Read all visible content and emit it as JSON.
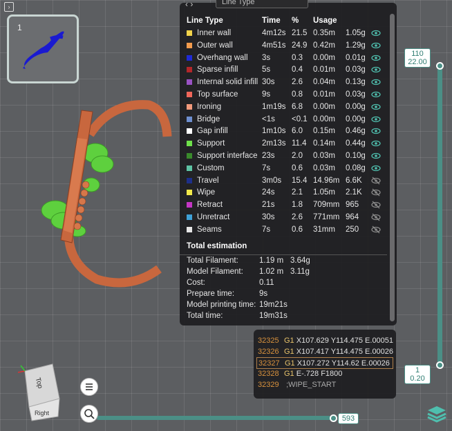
{
  "plate": {
    "number": "1"
  },
  "panel": {
    "header_label": "Line Type",
    "columns": {
      "type": "Line Type",
      "time": "Time",
      "pct": "%",
      "usage": "Usage"
    },
    "rows": [
      {
        "name": "Inner wall",
        "time": "4m12s",
        "pct": "21.5",
        "len": "0.35m",
        "wt": "1.05g",
        "color": "#f2d34a",
        "visible": true
      },
      {
        "name": "Outer wall",
        "time": "4m51s",
        "pct": "24.9",
        "len": "0.42m",
        "wt": "1.29g",
        "color": "#f29b4d",
        "visible": true
      },
      {
        "name": "Overhang wall",
        "time": "3s",
        "pct": "0.3",
        "len": "0.00m",
        "wt": "0.01g",
        "color": "#1f2bd6",
        "visible": true
      },
      {
        "name": "Sparse infill",
        "time": "5s",
        "pct": "0.4",
        "len": "0.01m",
        "wt": "0.03g",
        "color": "#b3272a",
        "visible": true
      },
      {
        "name": "Internal solid infill",
        "time": "30s",
        "pct": "2.6",
        "len": "0.04m",
        "wt": "0.13g",
        "color": "#9a52c4",
        "visible": true
      },
      {
        "name": "Top surface",
        "time": "9s",
        "pct": "0.8",
        "len": "0.01m",
        "wt": "0.03g",
        "color": "#f0665a",
        "visible": true
      },
      {
        "name": "Ironing",
        "time": "1m19s",
        "pct": "6.8",
        "len": "0.00m",
        "wt": "0.00g",
        "color": "#f29a7c",
        "visible": true
      },
      {
        "name": "Bridge",
        "time": "<1s",
        "pct": "<0.1",
        "len": "0.00m",
        "wt": "0.00g",
        "color": "#6e8fd0",
        "visible": true
      },
      {
        "name": "Gap infill",
        "time": "1m10s",
        "pct": "6.0",
        "len": "0.15m",
        "wt": "0.46g",
        "color": "#ffffff",
        "visible": true
      },
      {
        "name": "Support",
        "time": "2m13s",
        "pct": "11.4",
        "len": "0.14m",
        "wt": "0.44g",
        "color": "#6ee04a",
        "visible": true
      },
      {
        "name": "Support interface",
        "time": "23s",
        "pct": "2.0",
        "len": "0.03m",
        "wt": "0.10g",
        "color": "#3a8a2c",
        "visible": true
      },
      {
        "name": "Custom",
        "time": "7s",
        "pct": "0.6",
        "len": "0.03m",
        "wt": "0.08g",
        "color": "#5ec3a4",
        "visible": true
      },
      {
        "name": "Travel",
        "time": "3m0s",
        "pct": "15.4",
        "len": "14.96m",
        "wt": "6.6K",
        "color": "#1d2f8a",
        "visible": false
      },
      {
        "name": "Wipe",
        "time": "24s",
        "pct": "2.1",
        "len": "1.05m",
        "wt": "2.1K",
        "color": "#f2e94a",
        "visible": false
      },
      {
        "name": "Retract",
        "time": "21s",
        "pct": "1.8",
        "len": "709mm",
        "wt": "965",
        "color": "#c436c4",
        "visible": false
      },
      {
        "name": "Unretract",
        "time": "30s",
        "pct": "2.6",
        "len": "771mm",
        "wt": "964",
        "color": "#3fa2d8",
        "visible": false
      },
      {
        "name": "Seams",
        "time": "7s",
        "pct": "0.6",
        "len": "31mm",
        "wt": "250",
        "color": "#e6e6e6",
        "visible": false
      }
    ],
    "estimation": {
      "title": "Total estimation",
      "total_filament_label": "Total Filament:",
      "total_filament_len": "1.19 m",
      "total_filament_wt": "3.64g",
      "model_filament_label": "Model Filament:",
      "model_filament_len": "1.02 m",
      "model_filament_wt": "3.11g",
      "cost_label": "Cost:",
      "cost": "0.11",
      "prepare_label": "Prepare time:",
      "prepare": "9s",
      "model_print_label": "Model printing time:",
      "model_print": "19m21s",
      "total_time_label": "Total time:",
      "total_time": "19m31s"
    }
  },
  "gcode": [
    {
      "line": "32325",
      "cmd": "G1",
      "args": "X107.629 Y114.475 E.00051",
      "selected": false
    },
    {
      "line": "32326",
      "cmd": "G1",
      "args": "X107.417 Y114.475 E.00026",
      "selected": false
    },
    {
      "line": "32327",
      "cmd": "G1",
      "args": "X107.272 Y114.62 E.00026",
      "selected": true
    },
    {
      "line": "32328",
      "cmd": "G1",
      "args": "E-.728 F1800",
      "selected": false
    },
    {
      "line": "32329",
      "cmd": "",
      "args": ";WIPE_START",
      "selected": false
    }
  ],
  "layer_slider": {
    "top_layer": "110",
    "top_height": "22.00",
    "bottom_layer": "1",
    "bottom_height": "0.20"
  },
  "move_slider": {
    "value": "593"
  },
  "view_cube": {
    "top_label": "Top",
    "front_label": "Right"
  }
}
